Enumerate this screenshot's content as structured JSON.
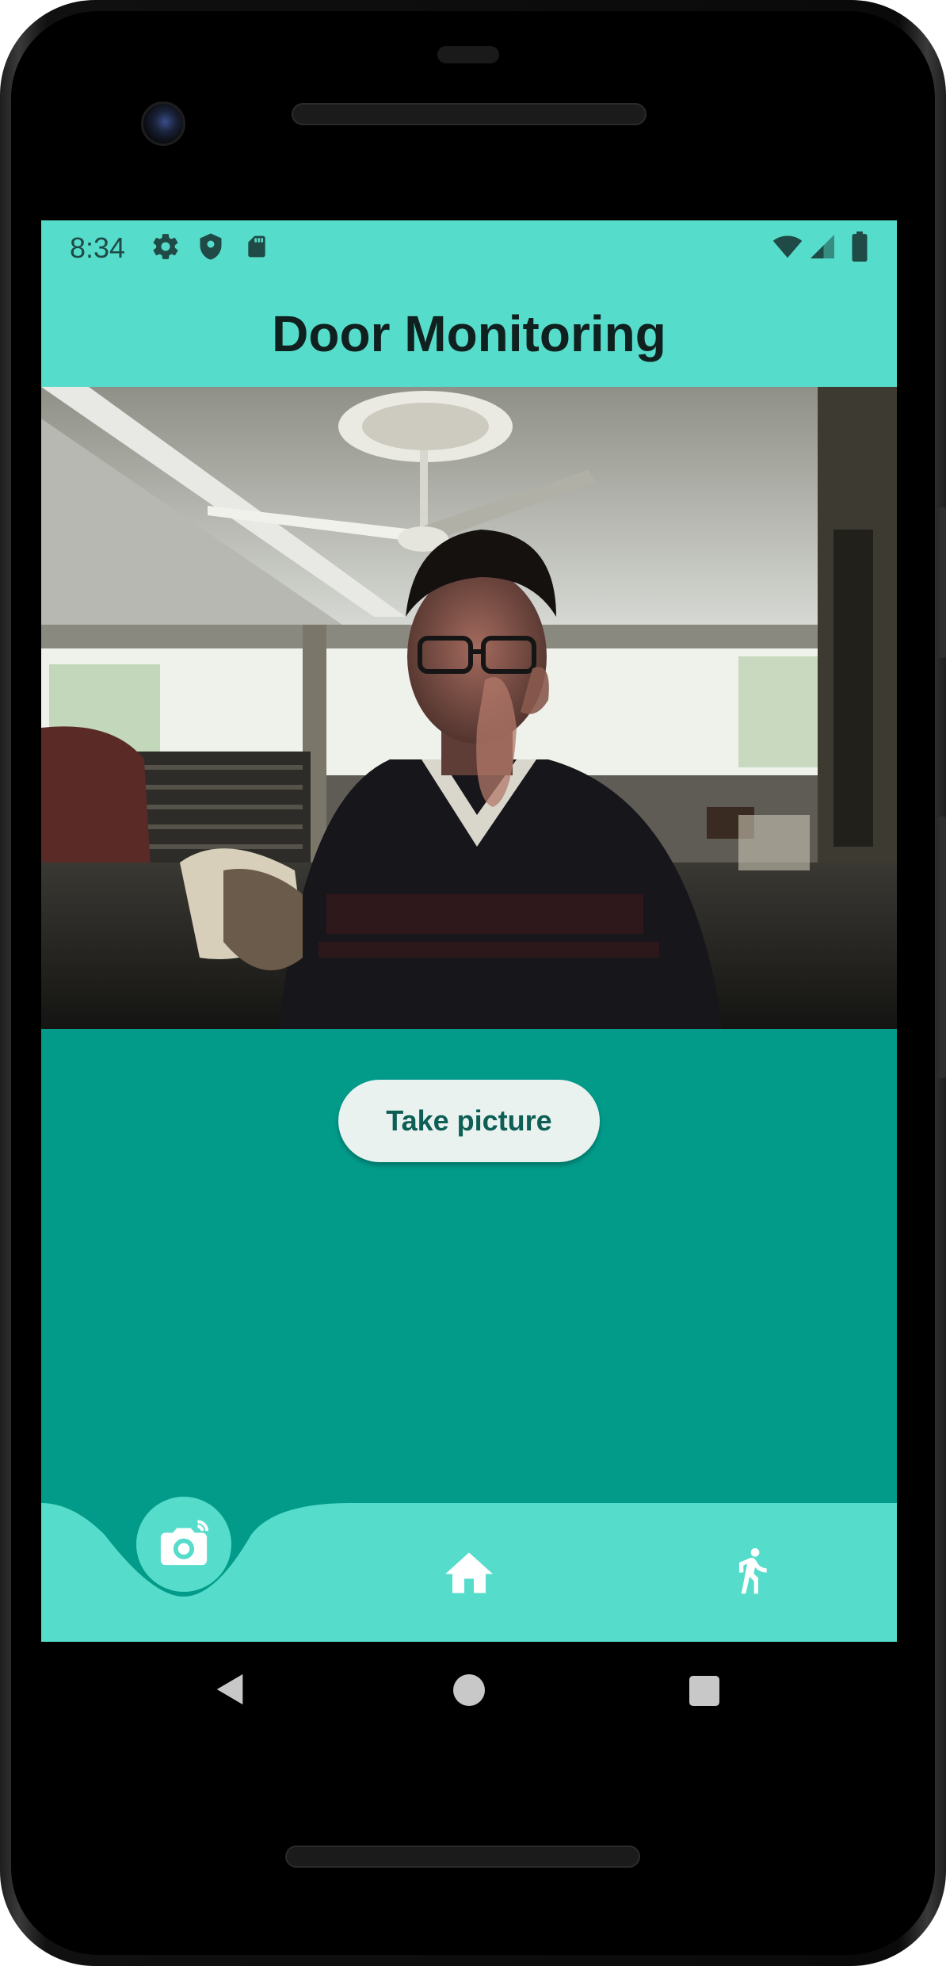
{
  "status_bar": {
    "time": "8:34",
    "icons_left": [
      "settings-icon",
      "shield-icon",
      "sd-card-icon"
    ],
    "icons_right": [
      "wifi-icon",
      "signal-icon",
      "battery-icon"
    ]
  },
  "app_bar": {
    "title": "Door Monitoring"
  },
  "main": {
    "take_picture_label": "Take picture"
  },
  "bottom_nav": {
    "items": [
      {
        "icon": "camera-icon",
        "selected": true
      },
      {
        "icon": "home-icon",
        "selected": false
      },
      {
        "icon": "running-person-icon",
        "selected": false
      }
    ]
  },
  "system_nav": {
    "items": [
      "back-icon",
      "home-circle-icon",
      "recents-icon"
    ]
  },
  "colors": {
    "accent_light": "#56dccb",
    "accent_dark": "#029b8a",
    "button_bg": "#e9f2ef",
    "button_text": "#0d5e55"
  }
}
